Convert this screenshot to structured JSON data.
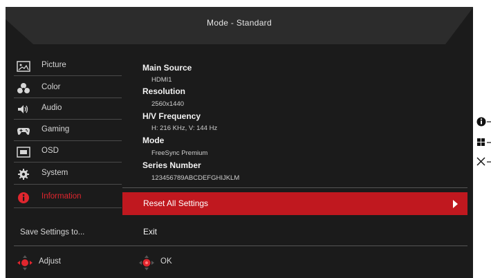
{
  "header": {
    "mode_title": "Mode - Standard"
  },
  "menu": {
    "items": [
      {
        "label": "Picture",
        "icon": "picture-icon"
      },
      {
        "label": "Color",
        "icon": "color-palette-icon"
      },
      {
        "label": "Audio",
        "icon": "speaker-icon"
      },
      {
        "label": "Gaming",
        "icon": "gamepad-icon"
      },
      {
        "label": "OSD",
        "icon": "osd-window-icon"
      },
      {
        "label": "System",
        "icon": "gear-icon"
      },
      {
        "label": "Information",
        "icon": "info-icon",
        "selected": true
      }
    ],
    "save_settings": "Save Settings to..."
  },
  "information": {
    "main_source_label": "Main Source",
    "main_source_value": "HDMI1",
    "resolution_label": "Resolution",
    "resolution_value": "2560x1440",
    "hv_frequency_label": "H/V Frequency",
    "hv_frequency_value": "H: 216 KHz, V: 144 Hz",
    "mode_label": "Mode",
    "mode_value": "FreeSync Premium",
    "series_number_label": "Series Number",
    "series_number_value": "123456789ABCDEFGHIJKLM"
  },
  "actions": {
    "reset_all_settings": "Reset All Settings",
    "exit": "Exit"
  },
  "footer": {
    "adjust_label": "Adjust",
    "ok_label": "OK"
  },
  "side_keys": [
    "info-icon",
    "grid-icon",
    "close-icon"
  ],
  "colors": {
    "accent": "#c0181f",
    "selected_text": "#e0262e",
    "background": "#1b1b1b"
  }
}
